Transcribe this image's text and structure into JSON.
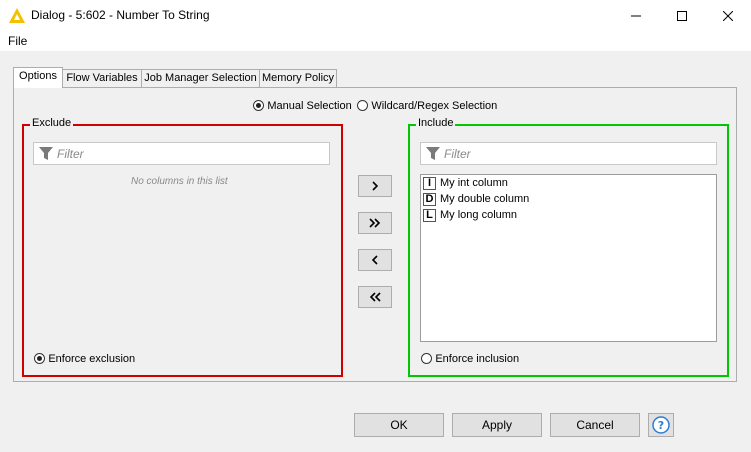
{
  "window": {
    "title": "Dialog - 5:602 - Number To String",
    "controls": [
      "minimize-icon",
      "maximize-icon",
      "close-icon"
    ]
  },
  "menu": {
    "file": "File"
  },
  "tabs": [
    {
      "label": "Options",
      "active": true
    },
    {
      "label": "Flow Variables",
      "active": false
    },
    {
      "label": "Job Manager Selection",
      "active": false
    },
    {
      "label": "Memory Policy",
      "active": false
    }
  ],
  "selection_mode": {
    "manual": "Manual Selection",
    "wildcard": "Wildcard/Regex Selection",
    "selected": "manual"
  },
  "exclude": {
    "title": "Exclude",
    "filter_placeholder": "Filter",
    "empty_message": "No columns in this list",
    "enforce_label": "Enforce exclusion",
    "enforce_selected": true,
    "border_color": "#d00000"
  },
  "include": {
    "title": "Include",
    "filter_placeholder": "Filter",
    "columns": [
      {
        "type": "I",
        "name": "My int column"
      },
      {
        "type": "D",
        "name": "My double column"
      },
      {
        "type": "L",
        "name": "My long column"
      }
    ],
    "enforce_label": "Enforce inclusion",
    "enforce_selected": false,
    "border_color": "#00c800"
  },
  "move_buttons": [
    "chevron-right-icon",
    "double-chevron-right-icon",
    "chevron-left-icon",
    "double-chevron-left-icon"
  ],
  "buttons": {
    "ok": "OK",
    "apply": "Apply",
    "cancel": "Cancel",
    "help": "?"
  },
  "colors": {
    "accent": "#1e78d7",
    "help": "#2b7cd3"
  }
}
